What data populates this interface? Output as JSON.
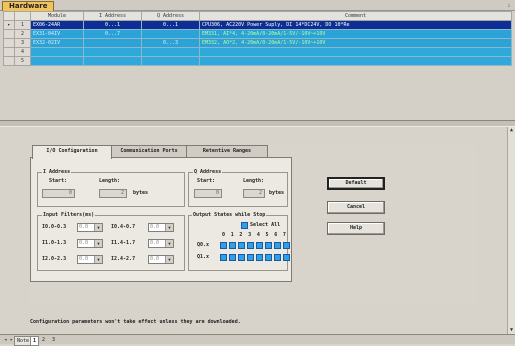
{
  "topbar": {
    "tab_label": "Hardware",
    "pin_glyph": "ᵢ"
  },
  "grid": {
    "headers": {
      "module": "Module",
      "i_address": "I Address",
      "q_address": "Q Address",
      "comment": "Comment"
    },
    "rows": [
      {
        "num": "1",
        "marker": "▸",
        "module": "EX06-24AR",
        "i_address": "0...1",
        "q_address": "0...1",
        "comment": "CPU306, AC220V Power Suply, DI 14*DC24V, DO 10*Re"
      },
      {
        "num": "2",
        "marker": "",
        "module": "EX31-04IV",
        "i_address": "0...7",
        "q_address": "",
        "comment": "EM331, AI*4, 4-20mA/0-20mA/1-5V/-10V~+10V"
      },
      {
        "num": "3",
        "marker": "",
        "module": "EX32-02IV",
        "i_address": "",
        "q_address": "0...3",
        "comment": "EM332, AO*2, 4-20mA/0-20mA/1-5V/-10V~+10V"
      },
      {
        "num": "4",
        "marker": ""
      },
      {
        "num": "5",
        "marker": ""
      }
    ]
  },
  "dialog": {
    "tabs": [
      "I/O Configuration",
      "Communication Ports",
      "Retentive Ranges"
    ],
    "i_address": {
      "title": "I Address",
      "start_label": "Start:",
      "length_label": "Length:",
      "start_value": "0",
      "length_value": "2",
      "unit": "bytes"
    },
    "q_address": {
      "title": "Q Address",
      "start_label": "Start:",
      "length_label": "Length:",
      "start_value": "0",
      "length_value": "2",
      "unit": "bytes"
    },
    "input_filters": {
      "title": "Input Filters(ms)",
      "rows": [
        {
          "l1": "I0.0-0.3",
          "v1": "0.0",
          "l2": "I0.4-0.7",
          "v2": "0.0"
        },
        {
          "l1": "I1.0-1.3",
          "v1": "0.0",
          "l2": "I1.4-1.7",
          "v2": "0.0"
        },
        {
          "l1": "I2.0-2.3",
          "v1": "0.0",
          "l2": "I2.4-2.7",
          "v2": "0.0"
        }
      ]
    },
    "output_states": {
      "title": "Output States while Stop",
      "select_all": "Select All",
      "bits": [
        "0",
        "1",
        "2",
        "3",
        "4",
        "5",
        "6",
        "7"
      ],
      "rows": [
        {
          "label": "Q0.x"
        },
        {
          "label": "Q1.x"
        }
      ]
    },
    "buttons": {
      "default": "Default",
      "cancel": "Cancel",
      "help": "Help"
    }
  },
  "info_text": "Configuration parameters won't take effect unless they are downloaded.",
  "statusbar": {
    "nav": "◂ ▸",
    "note": "Note",
    "tab1": "1",
    "tab2": "2",
    "tab3": "3"
  }
}
